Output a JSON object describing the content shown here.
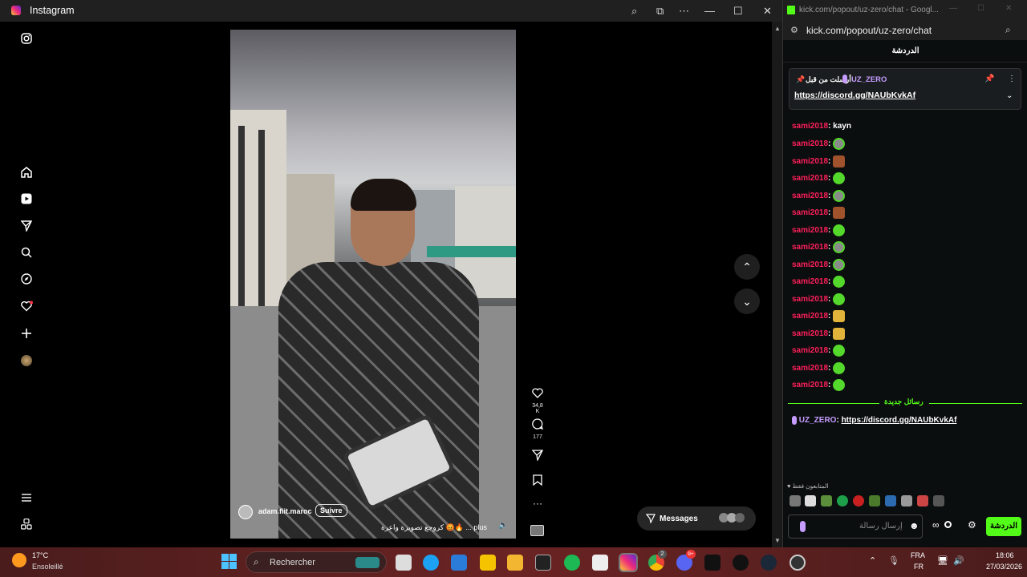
{
  "instagram": {
    "window_title": "Instagram",
    "video": {
      "username": "adam.fiit.maroc",
      "follow_label": "Suivre",
      "caption": "كروجع تصويرة واعرة 😡🔥 ... plus",
      "likes": "34,8 K",
      "comments": "177"
    },
    "messages_label": "Messages"
  },
  "chat": {
    "window_title": "kick.com/popout/uz-zero/chat - Googl...",
    "url": "kick.com/popout/uz-zero/chat",
    "header": "الدردشة",
    "pinned": {
      "pinned_by": "أرسلت من قبل",
      "user": "UZ_ZERO",
      "link": "https://discord.gg/NAUbKvkAf"
    },
    "first_msg": {
      "user": "sami2018",
      "text": "kayn"
    },
    "msg_user": "sami2018",
    "emote_rows": [
      "gray",
      "brown",
      "green",
      "gray",
      "brown",
      "green",
      "gray",
      "gray",
      "green",
      "green",
      "face",
      "face",
      "green",
      "green",
      "green"
    ],
    "new_messages_label": "رسائل جديدة",
    "last_msg": {
      "user": "UZ_ZERO",
      "text": "https://discord.gg/NAUbKvkAf"
    },
    "subscribers_only": "المتابعون فقط",
    "input_placeholder": "إرسال رسالة",
    "send_label": "الدردشة"
  },
  "taskbar": {
    "weather_temp": "17°C",
    "weather_desc": "Ensoleillé",
    "search_label": "Rechercher",
    "lang_top": "FRA",
    "lang_bottom": "FR",
    "time": "18:06",
    "date": "27/03/2026",
    "chrome_badge": "2",
    "discord_badge": "9+"
  },
  "colors": {
    "kick_green": "#53fc18",
    "chat_user": "#ff1f5a",
    "uz_zero": "#c59cff"
  }
}
